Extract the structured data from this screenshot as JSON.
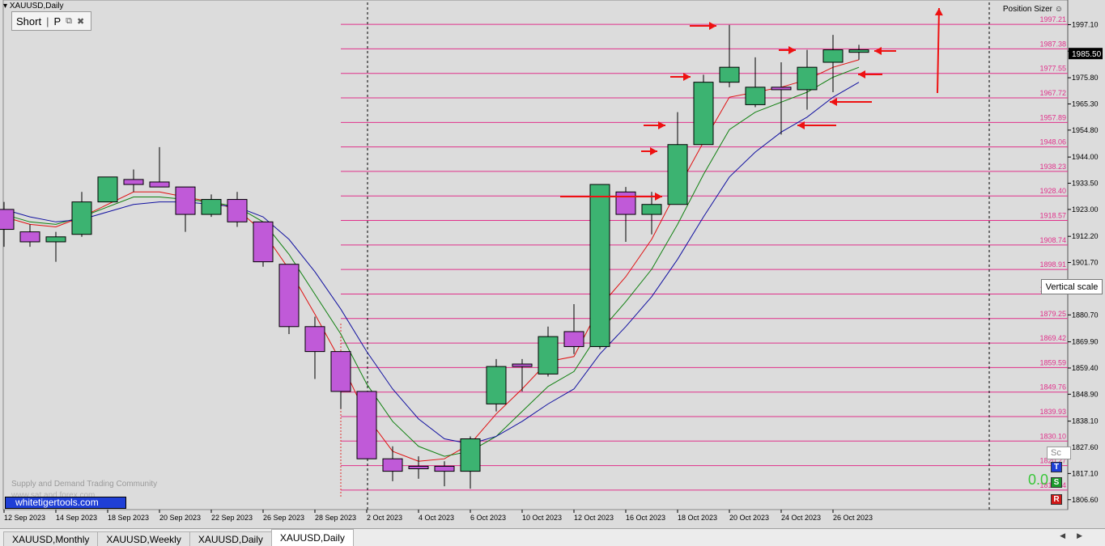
{
  "window": {
    "title": "XAUUSD,Daily"
  },
  "panel": {
    "label": "Short",
    "p_label": "P",
    "separator": "|"
  },
  "position_sizer": "Position Sizer",
  "tooltip": "Vertical scale",
  "branding": {
    "badge": "whitetigertools.com",
    "community": "Supply and Demand Trading Community",
    "url": "www.sat and forex com"
  },
  "indicator": {
    "value": "0.0",
    "sc": "Sc",
    "t": "T",
    "s": "S",
    "r": "R"
  },
  "tabs": [
    {
      "label": "XAUUSD,Monthly",
      "active": false
    },
    {
      "label": "XAUUSD,Weekly",
      "active": false
    },
    {
      "label": "XAUUSD,Daily",
      "active": false
    },
    {
      "label": "XAUUSD,Daily",
      "active": true
    }
  ],
  "colors": {
    "bull": "#3cb371",
    "bear": "#c05ad8",
    "ma_fast": "#e01010",
    "ma_mid": "#108010",
    "ma_slow": "#1010a0",
    "level": "#e0308a",
    "arrow": "#ee1111"
  },
  "chart_data": {
    "type": "candlestick",
    "symbol": "XAUUSD",
    "timeframe": "Daily",
    "current_price": "1985.50",
    "x_labels": [
      "12 Sep 2023",
      "14 Sep 2023",
      "18 Sep 2023",
      "20 Sep 2023",
      "22 Sep 2023",
      "26 Sep 2023",
      "28 Sep 2023",
      "2 Oct 2023",
      "4 Oct 2023",
      "6 Oct 2023",
      "10 Oct 2023",
      "12 Oct 2023",
      "16 Oct 2023",
      "18 Oct 2023",
      "20 Oct 2023",
      "24 Oct 2023",
      "26 Oct 2023"
    ],
    "y_ticks": [
      "1997.10",
      "1986.45",
      "1975.80",
      "1965.30",
      "1954.80",
      "1944.00",
      "1933.50",
      "1923.00",
      "1912.20",
      "1901.70",
      "1880.70",
      "1869.90",
      "1859.40",
      "1848.90",
      "1838.10",
      "1827.60",
      "1817.10",
      "1806.60"
    ],
    "ylim": [
      1803.6,
      2006.0
    ],
    "candles": [
      {
        "o": 1923,
        "h": 1926,
        "l": 1908,
        "c": 1915
      },
      {
        "o": 1914,
        "h": 1917,
        "l": 1908,
        "c": 1910
      },
      {
        "o": 1910,
        "h": 1914,
        "l": 1902,
        "c": 1912
      },
      {
        "o": 1913,
        "h": 1930,
        "l": 1912,
        "c": 1926
      },
      {
        "o": 1926,
        "h": 1936,
        "l": 1926,
        "c": 1936
      },
      {
        "o": 1935,
        "h": 1939,
        "l": 1930,
        "c": 1933
      },
      {
        "o": 1934,
        "h": 1948,
        "l": 1932,
        "c": 1932
      },
      {
        "o": 1932,
        "h": 1932,
        "l": 1914,
        "c": 1921
      },
      {
        "o": 1921,
        "h": 1929,
        "l": 1920,
        "c": 1927
      },
      {
        "o": 1927,
        "h": 1930,
        "l": 1916,
        "c": 1918
      },
      {
        "o": 1918,
        "h": 1918,
        "l": 1900,
        "c": 1902
      },
      {
        "o": 1901,
        "h": 1901,
        "l": 1873,
        "c": 1876
      },
      {
        "o": 1876,
        "h": 1880,
        "l": 1855,
        "c": 1866
      },
      {
        "o": 1866,
        "h": 1866,
        "l": 1843,
        "c": 1850
      },
      {
        "o": 1850,
        "h": 1850,
        "l": 1823,
        "c": 1823
      },
      {
        "o": 1823,
        "h": 1828,
        "l": 1814,
        "c": 1818
      },
      {
        "o": 1820,
        "h": 1824,
        "l": 1815,
        "c": 1819
      },
      {
        "o": 1820,
        "h": 1822,
        "l": 1812,
        "c": 1818
      },
      {
        "o": 1818,
        "h": 1832,
        "l": 1811,
        "c": 1831
      },
      {
        "o": 1845,
        "h": 1863,
        "l": 1842,
        "c": 1860
      },
      {
        "o": 1861,
        "h": 1863,
        "l": 1850,
        "c": 1860
      },
      {
        "o": 1857,
        "h": 1876,
        "l": 1856,
        "c": 1872
      },
      {
        "o": 1874,
        "h": 1885,
        "l": 1865,
        "c": 1868
      },
      {
        "o": 1868,
        "h": 1933,
        "l": 1867,
        "c": 1933
      },
      {
        "o": 1930,
        "h": 1932,
        "l": 1910,
        "c": 1921
      },
      {
        "o": 1921,
        "h": 1930,
        "l": 1913,
        "c": 1925
      },
      {
        "o": 1925,
        "h": 1962,
        "l": 1925,
        "c": 1949
      },
      {
        "o": 1949,
        "h": 1977,
        "l": 1949,
        "c": 1974
      },
      {
        "o": 1974,
        "h": 1997,
        "l": 1972,
        "c": 1980
      },
      {
        "o": 1965,
        "h": 1984,
        "l": 1964,
        "c": 1972
      },
      {
        "o": 1972,
        "h": 1982,
        "l": 1953,
        "c": 1971
      },
      {
        "o": 1971,
        "h": 1987,
        "l": 1963,
        "c": 1980
      },
      {
        "o": 1982,
        "h": 1993,
        "l": 1970,
        "c": 1987
      },
      {
        "o": 1986,
        "h": 1989,
        "l": 1983,
        "c": 1987
      }
    ],
    "levels": [
      "1997.21",
      "1987.38",
      "1977.55",
      "1967.72",
      "1957.89",
      "1948.06",
      "1938.23",
      "1928.40",
      "1918.57",
      "1908.74",
      "1898.91",
      "1889.08",
      "1879.25",
      "1869.42",
      "1859.59",
      "1849.76",
      "1839.93",
      "1830.10",
      "1820.27",
      "1810.44"
    ],
    "ma_fast": [
      1920,
      1917,
      1916,
      1920,
      1925,
      1930,
      1930,
      1928,
      1926,
      1923,
      1914,
      1899,
      1881,
      1862,
      1840,
      1826,
      1822,
      1823,
      1829,
      1841,
      1851,
      1862,
      1864,
      1884,
      1896,
      1911,
      1931,
      1950,
      1968,
      1970,
      1972,
      1975,
      1980,
      1983
    ],
    "ma_mid": [
      1921,
      1918,
      1917,
      1920,
      1924,
      1928,
      1928,
      1927,
      1926,
      1924,
      1918,
      1905,
      1889,
      1873,
      1853,
      1838,
      1828,
      1824,
      1826,
      1832,
      1842,
      1852,
      1858,
      1874,
      1886,
      1899,
      1917,
      1937,
      1955,
      1962,
      1966,
      1970,
      1976,
      1980
    ],
    "ma_slow": [
      1923,
      1920,
      1918,
      1919,
      1922,
      1925,
      1926,
      1926,
      1925,
      1924,
      1920,
      1911,
      1898,
      1883,
      1866,
      1851,
      1839,
      1831,
      1829,
      1832,
      1838,
      1845,
      1851,
      1865,
      1876,
      1888,
      1903,
      1920,
      1936,
      1946,
      1954,
      1960,
      1968,
      1974
    ]
  }
}
